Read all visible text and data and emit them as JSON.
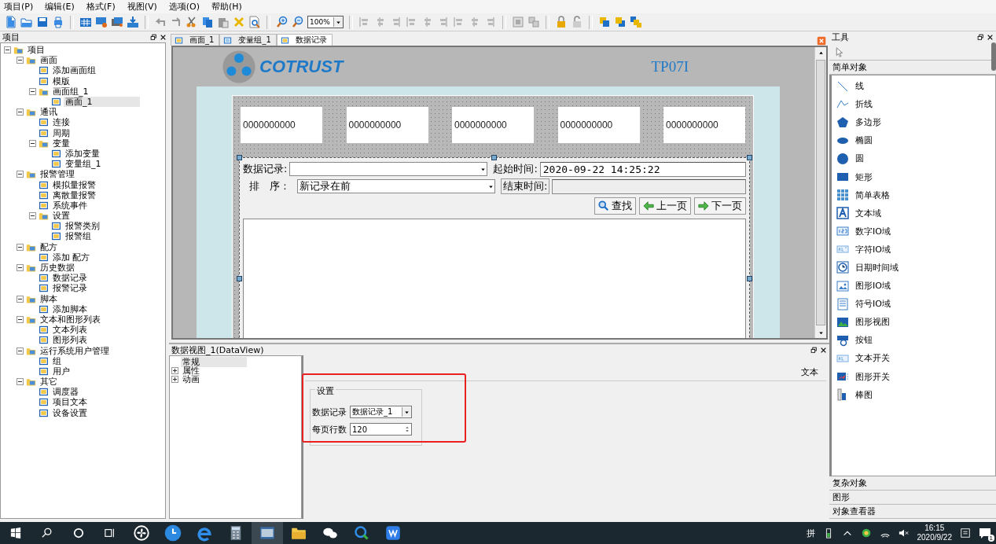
{
  "menu": [
    {
      "label": "项目(P)"
    },
    {
      "label": "编辑(E)"
    },
    {
      "label": "格式(F)"
    },
    {
      "label": "视图(V)"
    },
    {
      "label": "选项(O)"
    },
    {
      "label": "帮助(H)"
    }
  ],
  "toolbar": {
    "zoom": "100%"
  },
  "project_panel": {
    "title": "项目",
    "tree": [
      {
        "label": "项目",
        "selected": false,
        "expanded": true,
        "children": [
          {
            "label": "画面",
            "selected": false,
            "expanded": true,
            "children": [
              {
                "label": "添加画面组",
                "selected": false
              },
              {
                "label": "模版",
                "selected": false
              },
              {
                "label": "画面组_1",
                "selected": false,
                "expanded": true,
                "children": [
                  {
                    "label": "画面_1",
                    "selected": true
                  }
                ]
              }
            ]
          },
          {
            "label": "通讯",
            "selected": false,
            "expanded": true,
            "children": [
              {
                "label": "连接",
                "selected": false
              },
              {
                "label": "周期",
                "selected": false
              },
              {
                "label": "变量",
                "selected": false,
                "expanded": true,
                "children": [
                  {
                    "label": "添加变量",
                    "selected": false
                  },
                  {
                    "label": "变量组_1",
                    "selected": false
                  }
                ]
              }
            ]
          },
          {
            "label": "报警管理",
            "selected": false,
            "expanded": true,
            "children": [
              {
                "label": "模拟量报警",
                "selected": false
              },
              {
                "label": "离散量报警",
                "selected": false
              },
              {
                "label": "系统事件",
                "selected": false
              },
              {
                "label": "设置",
                "selected": false,
                "expanded": true,
                "children": [
                  {
                    "label": "报警类别",
                    "selected": false
                  },
                  {
                    "label": "报警组",
                    "selected": false
                  }
                ]
              }
            ]
          },
          {
            "label": "配方",
            "selected": false,
            "expanded": true,
            "children": [
              {
                "label": "添加 配方",
                "selected": false
              }
            ]
          },
          {
            "label": "历史数据",
            "selected": false,
            "expanded": true,
            "children": [
              {
                "label": "数据记录",
                "selected": false
              },
              {
                "label": "报警记录",
                "selected": false
              }
            ]
          },
          {
            "label": "脚本",
            "selected": false,
            "expanded": true,
            "children": [
              {
                "label": "添加脚本",
                "selected": false
              }
            ]
          },
          {
            "label": "文本和图形列表",
            "selected": false,
            "expanded": true,
            "children": [
              {
                "label": "文本列表",
                "selected": false
              },
              {
                "label": "图形列表",
                "selected": false
              }
            ]
          },
          {
            "label": "运行系统用户管理",
            "selected": false,
            "expanded": true,
            "children": [
              {
                "label": "组",
                "selected": false
              },
              {
                "label": "用户",
                "selected": false
              }
            ]
          },
          {
            "label": "其它",
            "selected": false,
            "expanded": true,
            "children": [
              {
                "label": "调度器",
                "selected": false
              },
              {
                "label": "项目文本",
                "selected": false
              },
              {
                "label": "设备设置",
                "selected": false
              }
            ]
          }
        ]
      }
    ]
  },
  "editor_tabs": [
    {
      "label": "画面_1",
      "selected": false
    },
    {
      "label": "变量组_1",
      "selected": false
    },
    {
      "label": "数据记录",
      "selected": true
    }
  ],
  "screen": {
    "logo": "COTRUST",
    "model": "TP07I",
    "number_fields": [
      "0000000000",
      "0000000000",
      "0000000000",
      "0000000000",
      "0000000000"
    ],
    "data_view": {
      "record_label": "数据记录:",
      "start_label": "起始时间:",
      "start_value": "2020-09-22 14:25:22",
      "sort_label": "排　序 :",
      "sort_value": "新记录在前",
      "end_button": "结束时间:",
      "buttons": [
        {
          "label": "查找",
          "kind": "search"
        },
        {
          "label": "上一页",
          "kind": "prev"
        },
        {
          "label": "下一页",
          "kind": "next"
        }
      ]
    }
  },
  "properties_panel": {
    "title": "数据视图_1(DataView)",
    "tree": [
      {
        "label": "常规",
        "selected": true
      },
      {
        "label": "属性",
        "selected": false,
        "expanded": false
      },
      {
        "label": "动画",
        "selected": false,
        "expanded": false
      }
    ],
    "tab": "文本",
    "group": "设置",
    "rows": [
      {
        "label": "数据记录",
        "value": "数据记录_1",
        "kind": "combo"
      },
      {
        "label": "每页行数",
        "value": "120",
        "kind": "spin"
      }
    ]
  },
  "tools_panel": {
    "title": "工具",
    "section": "简单对象",
    "items": [
      "线",
      "折线",
      "多边形",
      "椭圆",
      "圆",
      "矩形",
      "简单表格",
      "文本域",
      "数字IO域",
      "字符IO域",
      "日期时间域",
      "图形IO域",
      "符号IO域",
      "图形视图",
      "按钮",
      "文本开关",
      "图形开关",
      "棒图"
    ],
    "sections": [
      "复杂对象",
      "图形",
      "对象查看器"
    ]
  },
  "taskbar": {
    "ime": "拼",
    "time": "16:15",
    "date": "2020/9/22",
    "notifications": "1"
  }
}
